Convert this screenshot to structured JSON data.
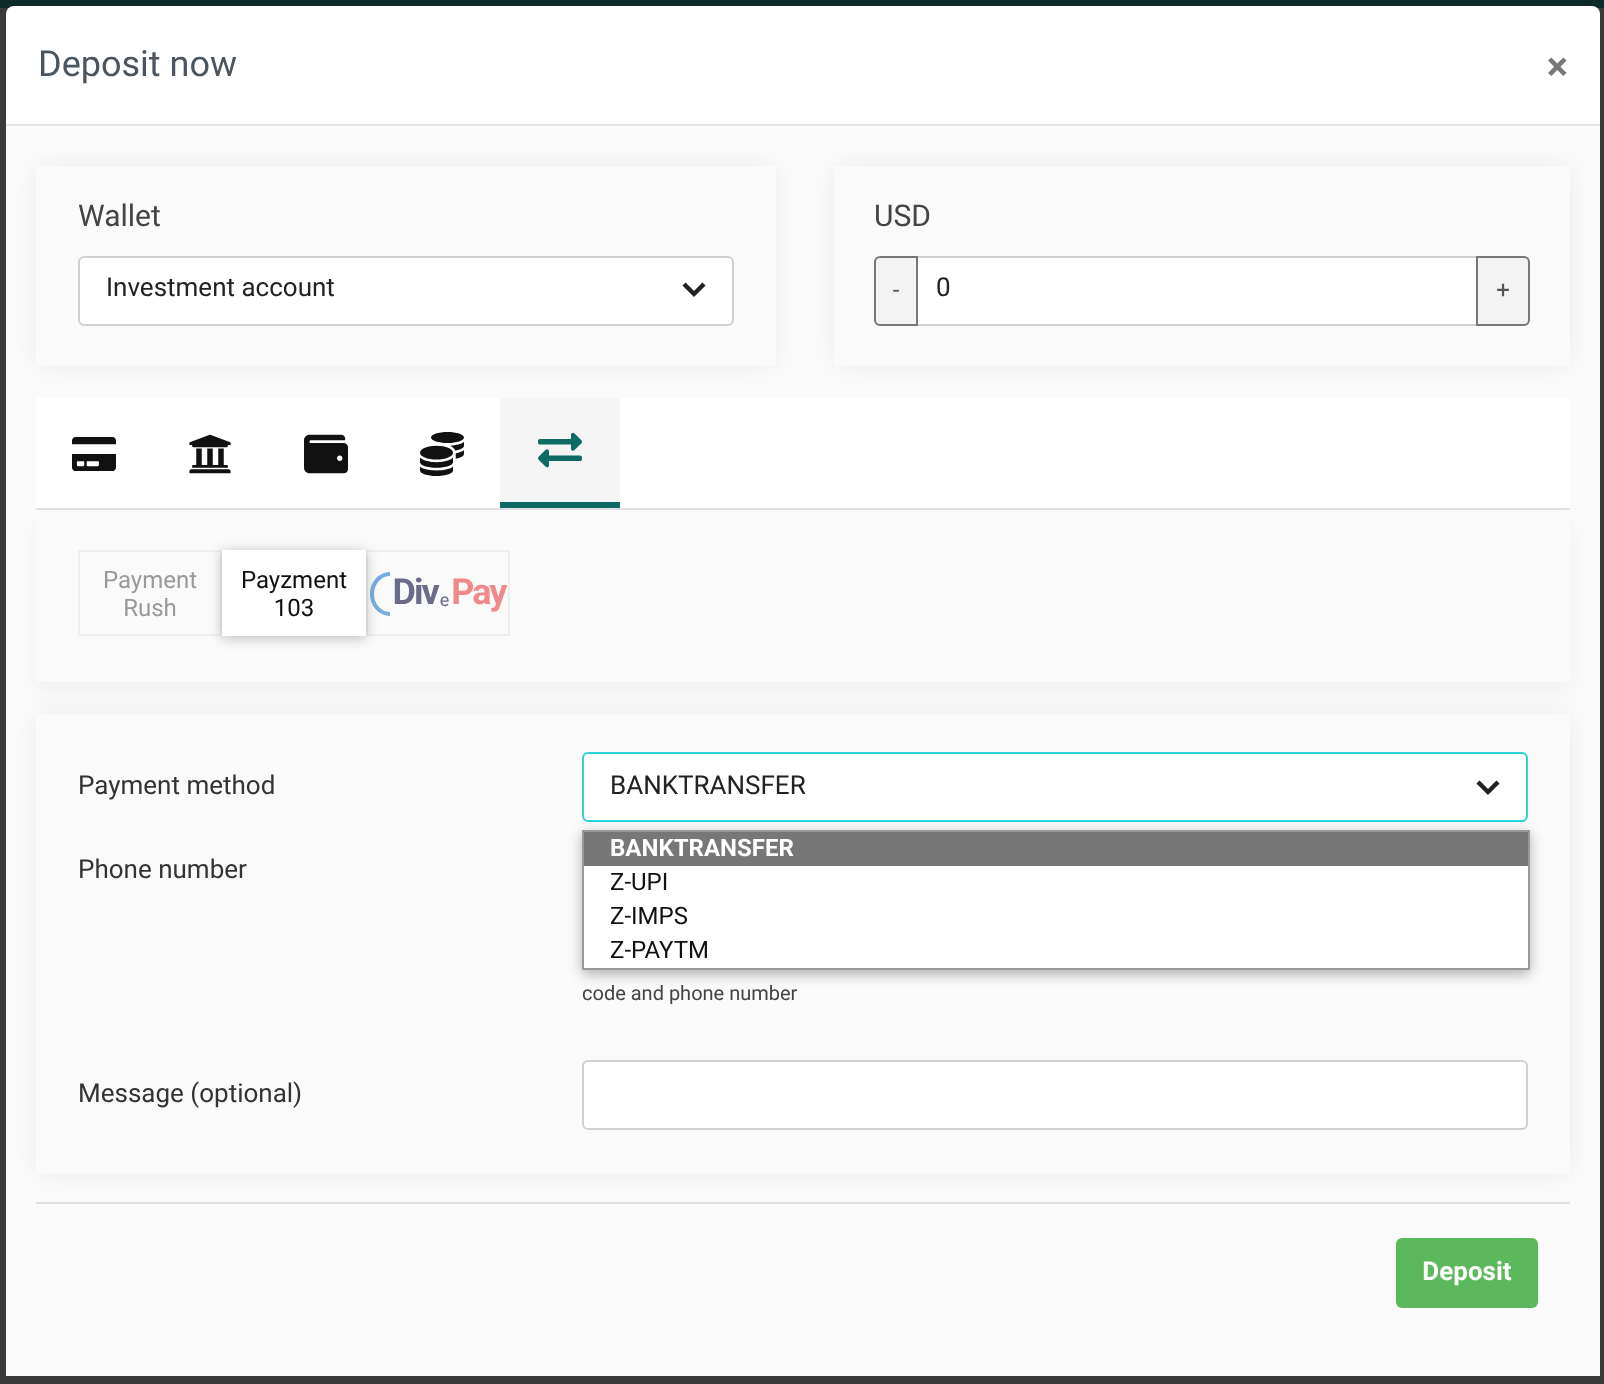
{
  "dialog": {
    "title": "Deposit now",
    "close": "×"
  },
  "wallet": {
    "label": "Wallet",
    "value": "Investment account"
  },
  "amount": {
    "label": "USD",
    "minus": "-",
    "value": "0",
    "plus": "+"
  },
  "tabs": [
    {
      "kind": "card",
      "selected": false
    },
    {
      "kind": "bank",
      "selected": false
    },
    {
      "kind": "wallet",
      "selected": false
    },
    {
      "kind": "coins",
      "selected": false
    },
    {
      "kind": "transfer",
      "selected": true
    }
  ],
  "providers": [
    {
      "kind": "text",
      "label": "Payment Rush",
      "selected": false
    },
    {
      "kind": "text",
      "label": "Payzment 103",
      "selected": true
    },
    {
      "kind": "logo",
      "parts": [
        "Div",
        "e",
        "Pay"
      ],
      "selected": false
    }
  ],
  "form": {
    "payment_method": {
      "label": "Payment method",
      "value": "BANKTRANSFER",
      "options": [
        {
          "label": "BANKTRANSFER",
          "selected": true
        },
        {
          "label": "Z-UPI",
          "selected": false
        },
        {
          "label": "Z-IMPS",
          "selected": false
        },
        {
          "label": "Z-PAYTM",
          "selected": false
        }
      ]
    },
    "phone": {
      "label": "Phone number",
      "hint": "code and phone number"
    },
    "message": {
      "label": "Message (optional)"
    }
  },
  "footer": {
    "button": "Deposit"
  }
}
